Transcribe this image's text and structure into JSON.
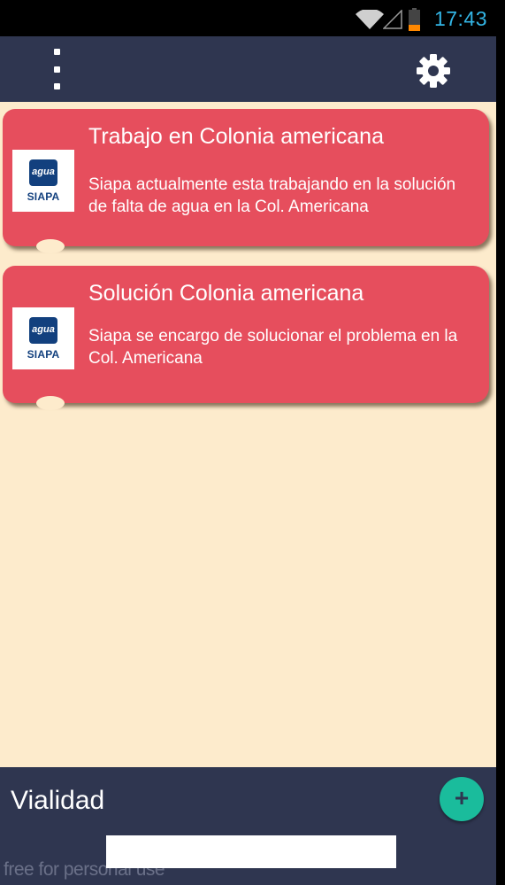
{
  "status_bar": {
    "time": "17:43",
    "accent_color": "#33b5e5",
    "icons": [
      "wifi-icon",
      "signal-icon",
      "battery-icon"
    ]
  },
  "app_bar": {
    "menu_icon": "overflow-menu-icon",
    "settings_icon": "gear-icon",
    "background_color": "#2f3650"
  },
  "cards": [
    {
      "title": "Trabajo en Colonia americana",
      "description": "Siapa actualmente esta trabajando en la solución de falta de agua en la Col. Americana",
      "logo_word": "agua",
      "logo_brand": "SIAPA"
    },
    {
      "title": "Solución Colonia americana",
      "description": "Siapa se encargo de solucionar el problema en la Col. Americana",
      "logo_word": "agua",
      "logo_brand": "SIAPA"
    }
  ],
  "bottom_bar": {
    "label": "Vialidad",
    "add_icon": "plus-icon",
    "add_symbol": "+",
    "watermark": "free for personal use"
  },
  "colors": {
    "card": "#e64e5d",
    "content_background": "#fdebcc",
    "fab": "#1abc9c"
  }
}
